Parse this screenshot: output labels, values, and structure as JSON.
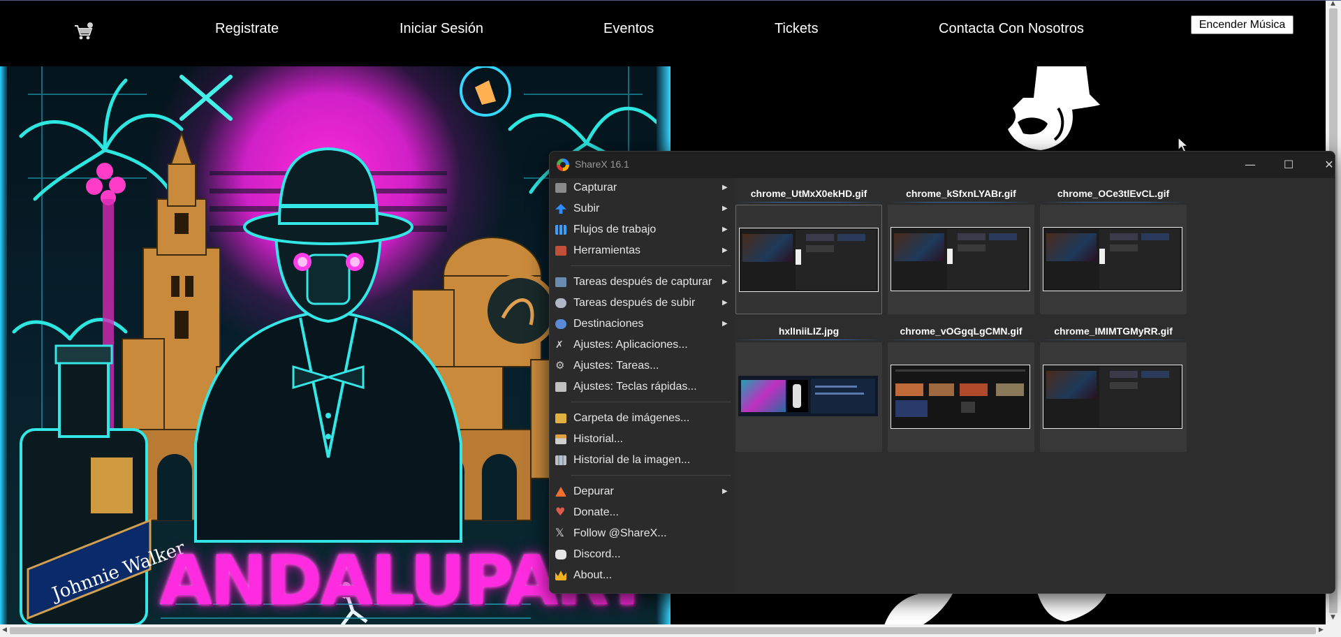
{
  "nav": {
    "links": [
      "Registrate",
      "Iniciar Sesión",
      "Eventos",
      "Tickets",
      "Contacta Con Nosotros"
    ],
    "music_button": "Encender Música"
  },
  "poster": {
    "title": "ANDALUPARTY",
    "bottle_label": "Johnnie Walker"
  },
  "sharex": {
    "title": "ShareX 16.1",
    "menu": [
      {
        "label": "Capturar",
        "submenu": true,
        "icon": "capture-icon"
      },
      {
        "label": "Subir",
        "submenu": true,
        "icon": "upload-arrow-icon"
      },
      {
        "label": "Flujos de trabajo",
        "submenu": true,
        "icon": "workflow-grid-icon"
      },
      {
        "label": "Herramientas",
        "submenu": true,
        "icon": "toolbox-icon"
      },
      {
        "label": "Tareas después de capturar",
        "submenu": true,
        "icon": "image-task-icon"
      },
      {
        "label": "Tareas después de subir",
        "submenu": true,
        "icon": "cloud-upload-icon"
      },
      {
        "label": "Destinaciones",
        "submenu": true,
        "icon": "globe-icon"
      },
      {
        "label": "Ajustes: Aplicaciones...",
        "submenu": false,
        "icon": "wrench-icon"
      },
      {
        "label": "Ajustes: Tareas...",
        "submenu": false,
        "icon": "gear-icon"
      },
      {
        "label": "Ajustes: Teclas rápidas...",
        "submenu": false,
        "icon": "keyboard-icon"
      },
      {
        "label": "Carpeta de imágenes...",
        "submenu": false,
        "icon": "folder-icon"
      },
      {
        "label": "Historial...",
        "submenu": false,
        "icon": "history-icon"
      },
      {
        "label": "Historial de la imagen...",
        "submenu": false,
        "icon": "image-history-icon"
      },
      {
        "label": "Depurar",
        "submenu": true,
        "icon": "traffic-cone-icon"
      },
      {
        "label": "Donate...",
        "submenu": false,
        "icon": "heart-icon"
      },
      {
        "label": "Follow @ShareX...",
        "submenu": false,
        "icon": "x-logo-icon"
      },
      {
        "label": "Discord...",
        "submenu": false,
        "icon": "discord-icon"
      },
      {
        "label": "About...",
        "submenu": false,
        "icon": "crown-icon"
      }
    ],
    "files": [
      {
        "name": "chrome_UtMxX0ekHD.gif",
        "selected": true
      },
      {
        "name": "chrome_kSfxnLYABr.gif",
        "selected": false
      },
      {
        "name": "chrome_OCe3tlEvCL.gif",
        "selected": false
      },
      {
        "name": "hxlIniiLIZ.jpg",
        "selected": false
      },
      {
        "name": "chrome_vOGgqLgCMN.gif",
        "selected": false
      },
      {
        "name": "chrome_IMIMTGMyRR.gif",
        "selected": false
      }
    ]
  },
  "colors": {
    "poster_neon_pink": "#ff2be0",
    "poster_neon_cyan": "#35d6ff",
    "sharex_bg": "#202020",
    "sharex_menu_bg": "#2b2b2b",
    "sharex_grid_bg": "#2d2d2d"
  }
}
